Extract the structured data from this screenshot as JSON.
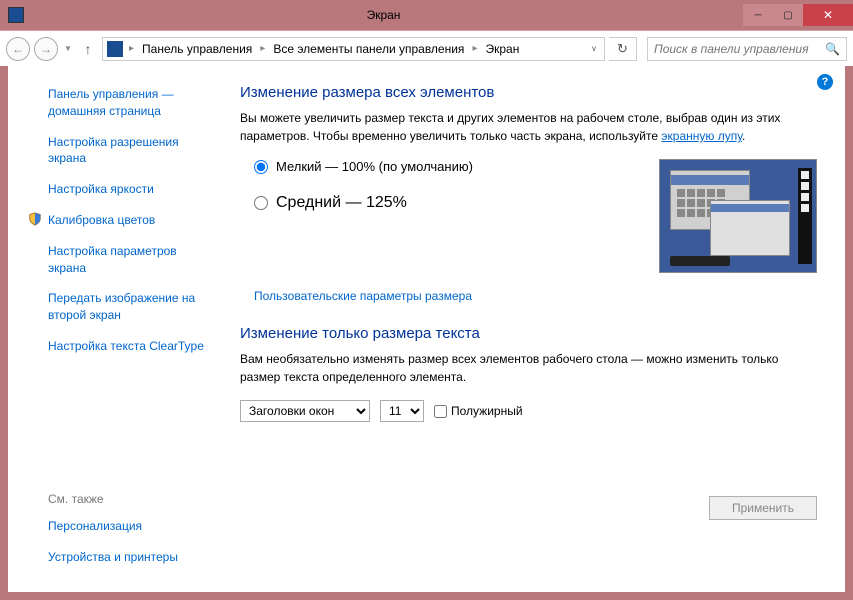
{
  "window": {
    "title": "Экран"
  },
  "breadcrumb": {
    "root": "Панель управления",
    "mid": "Все элементы панели управления",
    "leaf": "Экран"
  },
  "search": {
    "placeholder": "Поиск в панели управления"
  },
  "sidebar": {
    "home": "Панель управления — домашняя страница",
    "items": [
      "Настройка разрешения экрана",
      "Настройка яркости",
      "Калибровка цветов",
      "Настройка параметров экрана",
      "Передать изображение на второй экран",
      "Настройка текста ClearType"
    ],
    "see_also_label": "См. также",
    "see_also": [
      "Персонализация",
      "Устройства и принтеры"
    ]
  },
  "main": {
    "heading1": "Изменение размера всех элементов",
    "desc1_a": "Вы можете увеличить размер текста и других элементов на рабочем столе, выбрав один из этих параметров. Чтобы временно увеличить только часть экрана, используйте ",
    "desc1_link": "экранную лупу",
    "desc1_b": ".",
    "radio_small": "Мелкий — 100% (по умолчанию)",
    "radio_medium": "Средний — 125%",
    "custom_link": "Пользовательские параметры размера",
    "heading2": "Изменение только размера текста",
    "desc2": "Вам необязательно изменять размер всех элементов рабочего стола — можно изменить только размер текста определенного элемента.",
    "element_select": "Заголовки окон",
    "size_select": "11",
    "bold_label": "Полужирный",
    "apply": "Применить"
  }
}
